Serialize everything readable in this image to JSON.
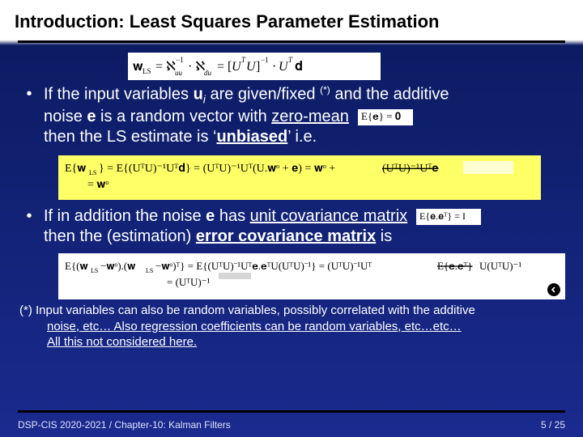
{
  "title": "Introduction: Least Squares Parameter Estimation",
  "bullets": {
    "b1_line1_a": "If the input variables ",
    "b1_line1_b": "u",
    "b1_line1_c": " are given/fixed ",
    "b1_line1_d": "(*)",
    "b1_line1_e": " and the additive",
    "b1_line2_a": "noise ",
    "b1_line2_b": "e",
    "b1_line2_c": "  is a random vector with ",
    "b1_line2_d": "zero-mean",
    "b1_line3_a": "then the LS estimate is ‘",
    "b1_line3_b": "unbiased",
    "b1_line3_c": "’ i.e.",
    "b2_line1_a": "If in addition the noise ",
    "b2_line1_b": "e",
    "b2_line1_c": " has ",
    "b2_line1_d": "unit covariance matrix",
    "b2_line2_a": "then the (estimation) ",
    "b2_line2_b": "error covariance matrix",
    "b2_line2_c": " is"
  },
  "footnote": {
    "line1": "(*) Input variables can also be random variables, possibly correlated with the additive",
    "line2": "noise, etc… Also regression coefficients can be random variables, etc…etc…",
    "line3": "All this not considered here."
  },
  "footer": {
    "left": "DSP-CIS 2020-2021 /  Chapter-10: Kalman Filters",
    "page": "5 / 25"
  },
  "sub_i": "i"
}
